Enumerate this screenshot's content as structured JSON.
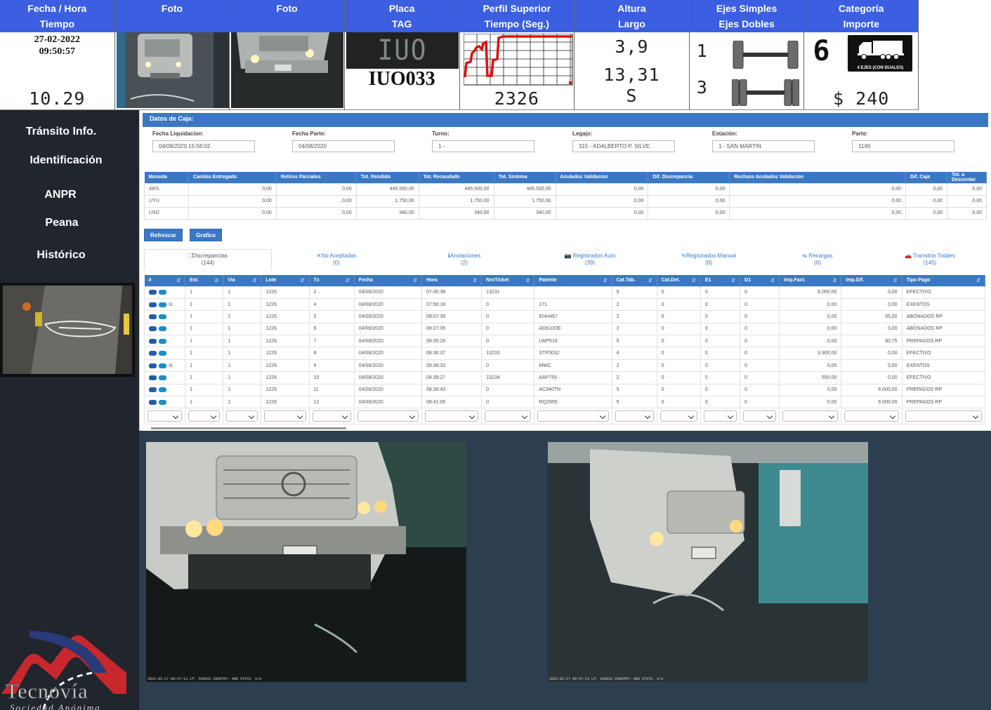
{
  "header": {
    "c1": [
      "Fecha / Hora",
      "Tiempo"
    ],
    "c2": [
      "Foto",
      ""
    ],
    "c3": [
      "Foto",
      ""
    ],
    "c4": [
      "Placa",
      "TAG"
    ],
    "c5": [
      "Perfil Superior",
      "Tiempo (Seg.)"
    ],
    "c6": [
      "Altura",
      "Largo"
    ],
    "c7": [
      "Ejes Simples",
      "Ejes Dobles"
    ],
    "c8": [
      "Categoría",
      "Importe"
    ]
  },
  "transit": {
    "date": "27-02-2022",
    "time": "09:50:57",
    "elapsed": "10.29",
    "plate_image_text": "IUO 033",
    "plate": "IUO033",
    "profile_time": "2326",
    "height": "3,9",
    "length": "13,31",
    "length_unit": "S",
    "single_axles": "1",
    "double_axles": "3",
    "category": "6",
    "category_badge": "4 EJES (CON DUALES)",
    "amount": "$ 240"
  },
  "sidebar": {
    "items": [
      "Tránsito Info.",
      "Identificación",
      "ANPR",
      "Peana",
      "Histórico"
    ],
    "logo": "Tecnovía",
    "logo_sub": "Sociedad Anónima"
  },
  "caja": {
    "title": "Datos de Caja:",
    "fields": [
      {
        "label": "Fecha Liquidacion:",
        "value": "04/08/2020 15:58:02"
      },
      {
        "label": "Fecha Parte:",
        "value": "04/08/2020"
      },
      {
        "label": "Turno:",
        "value": "1 -"
      },
      {
        "label": "Legajo:",
        "value": "315 - ADALBERTO P. SILVE"
      },
      {
        "label": "Estación:",
        "value": "1 - SAN MARTIN"
      },
      {
        "label": "Parte:",
        "value": "1149"
      }
    ],
    "columns": [
      "Moneda",
      "Cambio Entregado",
      "Retiros Parciales",
      "Tot. Rendido",
      "Tot. Recaudado",
      "Tot. Sistema",
      "Anulados Validacion",
      "Dif. Discrepancia",
      "Rechazo Anulados Validacion",
      "Dif. Caja",
      "Tot. a Descontar"
    ],
    "rows": [
      [
        "ARS",
        "0,00",
        "0,00",
        "445.550,00",
        "445.500,00",
        "445.500,00",
        "0,00",
        "0,00",
        "0,00",
        "0,00",
        "0,00"
      ],
      [
        "UYU",
        "0,00",
        "0,00",
        "1.750,00",
        "1.750,00",
        "1.750,00",
        "0,00",
        "0,00",
        "0,00",
        "0,00",
        "0,00"
      ],
      [
        "USD",
        "0,00",
        "0,00",
        "340,00",
        "340,00",
        "340,00",
        "0,00",
        "0,00",
        "0,00",
        "0,00",
        "0,00"
      ]
    ],
    "buttons": [
      "Refrescar",
      "Grafico"
    ]
  },
  "tabs": [
    {
      "label": "⛶Discrepancias",
      "count": "(144)"
    },
    {
      "label": "✕No Aceptadas",
      "count": "(0)"
    },
    {
      "label": "ℹAnulaciones",
      "count": "(2)"
    },
    {
      "label": "Registrados Auto",
      "count": "(39)"
    },
    {
      "label": "Registrados Manual",
      "count": "(0)"
    },
    {
      "label": "Recargas",
      "count": "(0)"
    },
    {
      "label": "Transitos Totales",
      "count": "(145)"
    }
  ],
  "grid": {
    "columns": [
      "#",
      "Est.",
      "Via",
      "Lote",
      "Tx",
      "Fecha",
      "Hora",
      "NroTicket",
      "Patente",
      "Cat.Tab.",
      "Cat.Det.",
      "E1",
      "D1",
      "Imp.Fact.",
      "Imp.Dif.",
      "Tipo Pago"
    ],
    "rows": [
      [
        "1",
        "1",
        "1226",
        "2",
        "04/08/2020",
        "07:45:38",
        "13231",
        "",
        "5",
        "0",
        "0",
        "0",
        "6.000,00",
        "0,00",
        "EFECTIVO"
      ],
      [
        "1",
        "1",
        "1226",
        "4",
        "04/08/2020",
        "07:56:18",
        "0",
        "171",
        "2",
        "0",
        "0",
        "0",
        "0,00",
        "0,00",
        "EXENTOS"
      ],
      [
        "1",
        "1",
        "1226",
        "5",
        "04/08/2020",
        "08:07:39",
        "0",
        "EHH467",
        "2",
        "0",
        "0",
        "0",
        "0,00",
        "55,00",
        "ABONADOS RP"
      ],
      [
        "1",
        "1",
        "1226",
        "6",
        "04/08/2020",
        "08:27:06",
        "0",
        "AD610OE",
        "2",
        "0",
        "0",
        "0",
        "0,00",
        "0,00",
        "ABONADOS RP"
      ],
      [
        "1",
        "1",
        "1226",
        "7",
        "04/08/2020",
        "08:35:29",
        "0",
        "LWP519",
        "5",
        "0",
        "0",
        "0",
        "0,00",
        "80,75",
        "PREPAGOS RP"
      ],
      [
        "1",
        "1",
        "1226",
        "8",
        "04/08/2020",
        "08:36:37",
        "13233",
        "STP5032",
        "4",
        "0",
        "0",
        "0",
        "3.900,00",
        "0,00",
        "EFECTIVO"
      ],
      [
        "1",
        "1",
        "1226",
        "9",
        "04/08/2020",
        "08:38:32",
        "0",
        "MWC",
        "2",
        "0",
        "0",
        "0",
        "0,00",
        "0,00",
        "EXENTOS"
      ],
      [
        "1",
        "1",
        "1226",
        "10",
        "04/08/2020",
        "08:39:27",
        "13234",
        "AAP755",
        "2",
        "0",
        "0",
        "0",
        "550,00",
        "0,00",
        "EFECTIVO"
      ],
      [
        "1",
        "1",
        "1226",
        "11",
        "04/08/2020",
        "08:39:43",
        "0",
        "AC940TN",
        "5",
        "0",
        "0",
        "0",
        "0,00",
        "6.000,00",
        "PREPAGOS RP"
      ],
      [
        "1",
        "1",
        "1226",
        "12",
        "04/08/2020",
        "08:41:09",
        "0",
        "RQZ855",
        "5",
        "0",
        "0",
        "0",
        "0,00",
        "6.000,00",
        "PREPAGOS RP"
      ]
    ]
  },
  "cameras": {
    "stamp": "2022-02-27 09:47:13 LP: IUO033 COUNTRY: ARG STATE: n/a"
  }
}
